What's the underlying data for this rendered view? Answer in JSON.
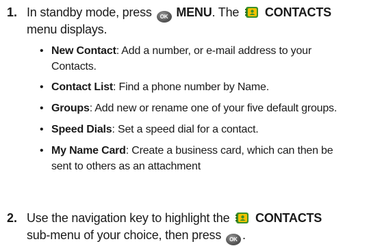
{
  "step1": {
    "number": "1.",
    "pre": "In standby mode, press",
    "ok_label": "OK",
    "menu": "MENU",
    "the": ". The",
    "contacts": "CONTACTS",
    "line2": "menu displays."
  },
  "bullets": [
    {
      "term": "New Contact",
      "desc": ": Add a number, or e-mail address to your",
      "desc2": "Contacts."
    },
    {
      "term": "Contact List",
      "desc": ": Find a phone number by Name.",
      "desc2": ""
    },
    {
      "term": "Groups",
      "desc": ": Add new or rename one of your five default groups.",
      "desc2": ""
    },
    {
      "term": "Speed Dials",
      "desc": ": Set a speed dial for a contact.",
      "desc2": ""
    },
    {
      "term": "My Name Card",
      "desc": ": Create a business card, which can then be",
      "desc2": "sent to others as an attachment"
    }
  ],
  "bullet_char": "•",
  "step2": {
    "number": "2.",
    "pre": "Use the navigation key to highlight the",
    "contacts": "CONTACTS",
    "line2": "sub-menu of your choice, then press",
    "end": ".",
    "ok_label": "OK"
  },
  "icons": {
    "ok": "ok-key-icon",
    "contacts": "contacts-book-icon"
  },
  "colors": {
    "contacts_green": "#3a8f2a",
    "contacts_yellow": "#f2c200",
    "ok_gray": "#5a5a5a"
  }
}
